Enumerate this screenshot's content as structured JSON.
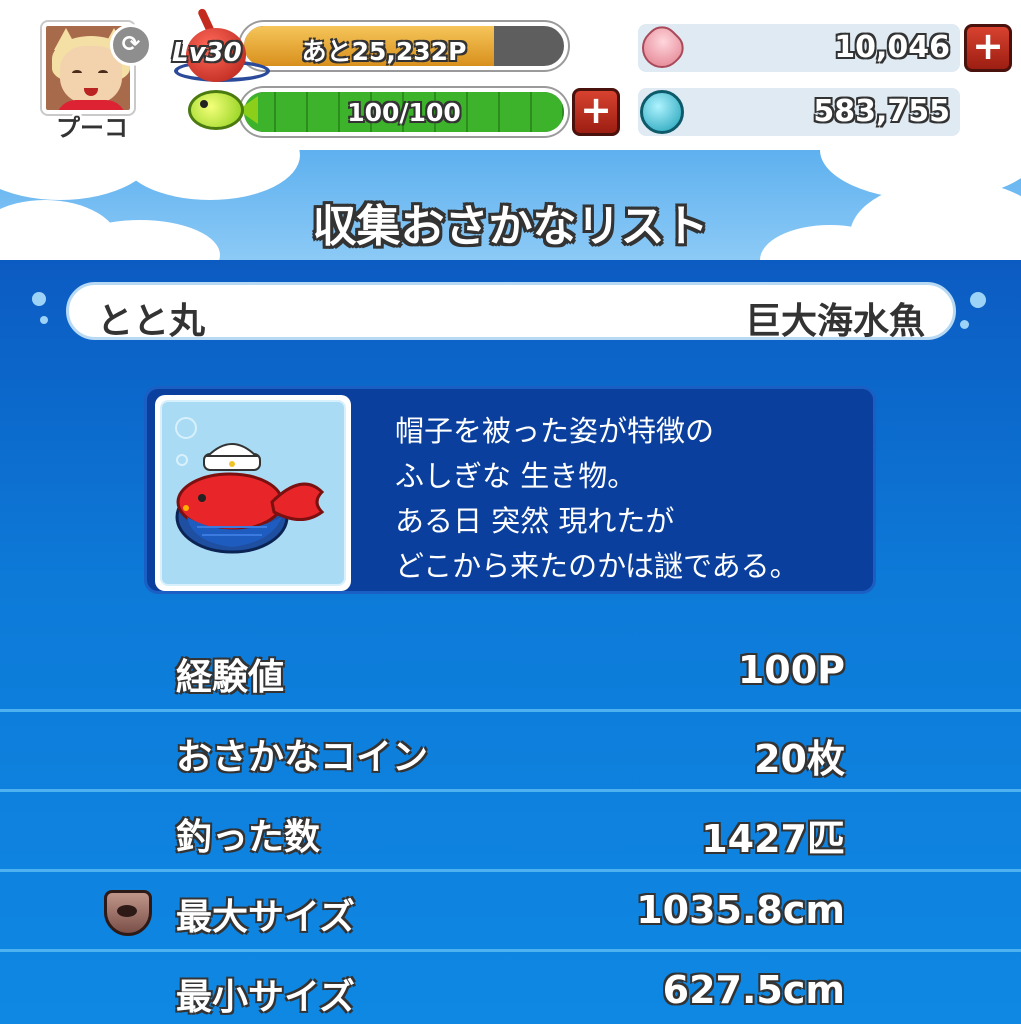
{
  "player": {
    "name": "プーコ",
    "level": "Lv30"
  },
  "exp": {
    "label": "あと25,232P",
    "fill_fraction": 0.78
  },
  "stamina": {
    "label": "100/100",
    "fill_fraction": 1.0
  },
  "currency": {
    "gems": "10,046",
    "coins": "583,755"
  },
  "icons": {
    "swap": "swap-icon",
    "fish": "fish-stamina-icon",
    "gem": "gem-icon",
    "coin": "coin-icon",
    "plus": "plus-icon",
    "record": "record-crown-icon",
    "fish_image": "whale-fish-image"
  },
  "screen": {
    "title": "収集おさかなリスト"
  },
  "fish": {
    "name": "とと丸",
    "category": "巨大海水魚",
    "description": [
      "帽子を被った姿が特徴の",
      "ふしぎな 生き物。",
      "ある日 突然 現れたが",
      "どこから来たのかは謎である。"
    ]
  },
  "stats": [
    {
      "label": "経験値",
      "value": "100P"
    },
    {
      "label": "おさかなコイン",
      "value": "20枚"
    },
    {
      "label": "釣った数",
      "value": "1427匹"
    },
    {
      "label": "最大サイズ",
      "value": "1035.8cm"
    },
    {
      "label": "最小サイズ",
      "value": "627.5cm"
    }
  ],
  "colors": {
    "accent_red": "#c7301f",
    "panel_blue": "#0d7ad8",
    "exp_orange": "#e7a431",
    "stamina_green": "#3cb32a"
  }
}
